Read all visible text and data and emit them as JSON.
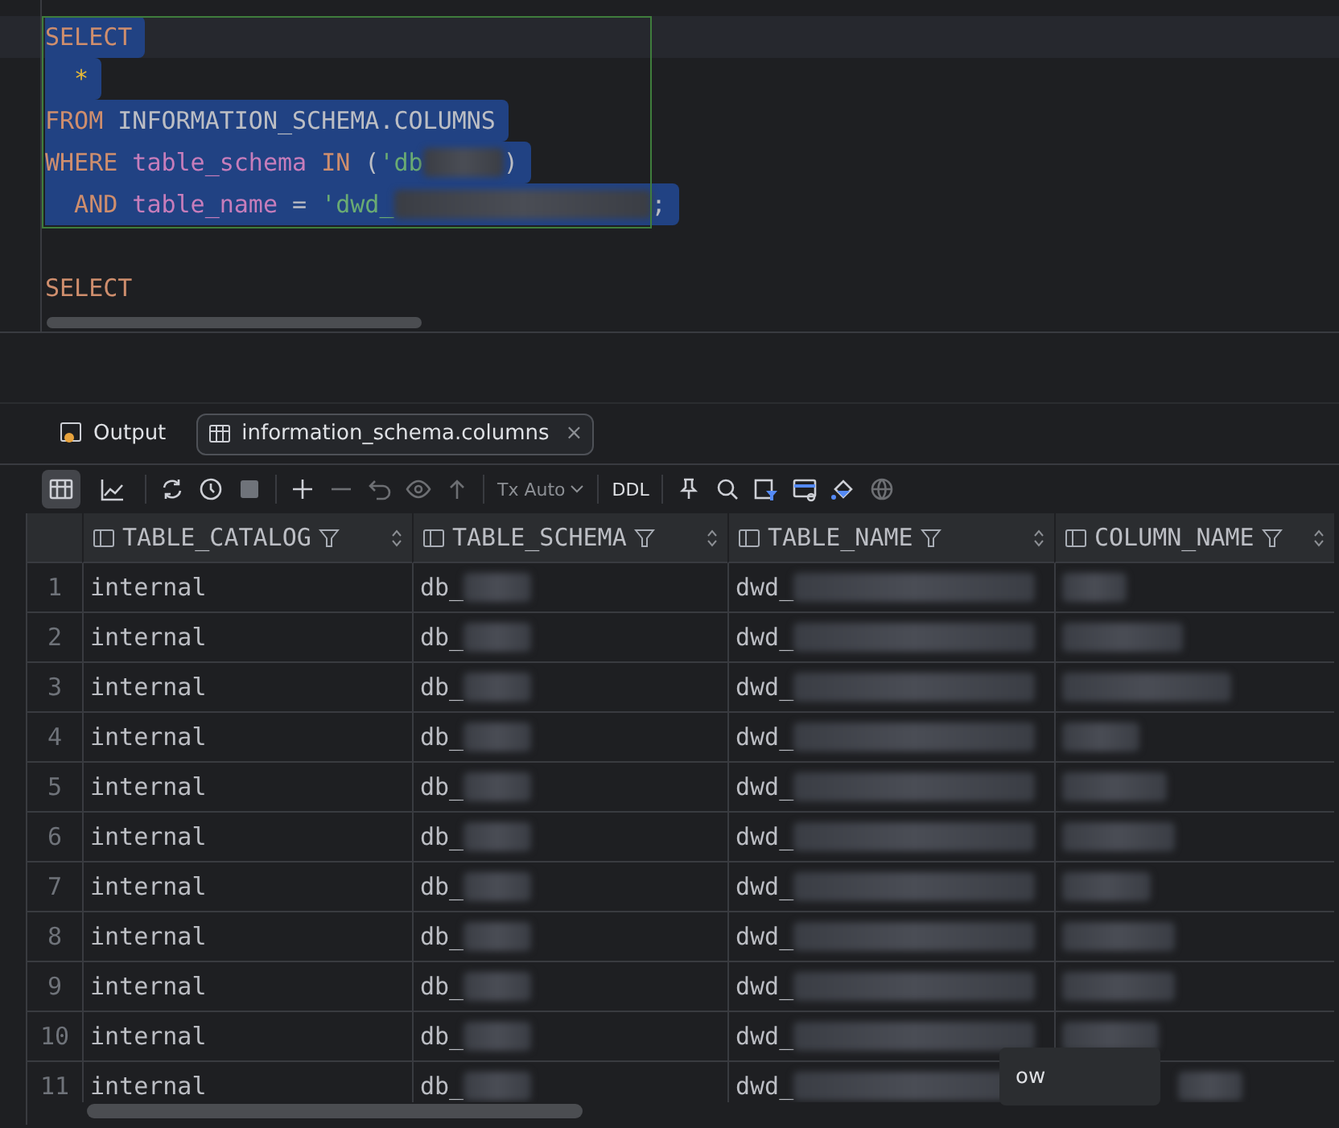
{
  "editor": {
    "lines": [
      {
        "selected": true,
        "current": true,
        "tokens": [
          {
            "text": "SELECT",
            "kind": "keyword"
          }
        ]
      },
      {
        "selected": true,
        "current": false,
        "tokens": [
          {
            "text": "  *",
            "kind": "star"
          }
        ]
      },
      {
        "selected": true,
        "current": false,
        "tokens": [
          {
            "text": "FROM",
            "kind": "keyword"
          },
          {
            "text": " INFORMATION_SCHEMA.COLUMNS",
            "kind": "plain"
          }
        ]
      },
      {
        "selected": true,
        "current": false,
        "tokens": [
          {
            "text": "WHERE",
            "kind": "keyword"
          },
          {
            "text": " table_schema",
            "kind": "column"
          },
          {
            "text": " IN",
            "kind": "keyword"
          },
          {
            "text": " (",
            "kind": "plain"
          },
          {
            "text": "'db",
            "kind": "string"
          },
          {
            "kind": "blur"
          },
          {
            "text": ")",
            "kind": "plain"
          }
        ]
      },
      {
        "selected": true,
        "current": false,
        "tokens": [
          {
            "text": "  AND",
            "kind": "keyword"
          },
          {
            "text": " table_name",
            "kind": "column"
          },
          {
            "text": " = ",
            "kind": "plain"
          },
          {
            "text": "'dwd_",
            "kind": "string"
          },
          {
            "kind": "blur"
          },
          {
            "text": ";",
            "kind": "plain"
          }
        ]
      },
      {
        "selected": false,
        "current": false
      },
      {
        "selected": false,
        "current": false,
        "tokens": [
          {
            "text": "SELECT",
            "kind": "keyword"
          }
        ]
      }
    ]
  },
  "result_tabs": [
    {
      "kind": "output",
      "label": "Output",
      "selected": false
    },
    {
      "kind": "table",
      "label": "information_schema.columns",
      "selected": true,
      "close": "×"
    }
  ],
  "toolbar": {
    "views": [
      {
        "kind": "table",
        "selected": true
      },
      {
        "kind": "chart",
        "selected": false
      }
    ],
    "transaction_mode": "Tx Auto",
    "ddl": "DDL"
  },
  "grid": {
    "columns": [
      "TABLE_CATALOG",
      "TABLE_SCHEMA",
      "TABLE_NAME",
      "COLUMN_NAME"
    ],
    "rows": [
      {
        "number": "1",
        "table_catalog": "internal",
        "table_schema": "db_",
        "table_name": "dwd_"
      },
      {
        "number": "2",
        "table_catalog": "internal",
        "table_schema": "db_",
        "table_name": "dwd_"
      },
      {
        "number": "3",
        "table_catalog": "internal",
        "table_schema": "db_",
        "table_name": "dwd_"
      },
      {
        "number": "4",
        "table_catalog": "internal",
        "table_schema": "db_",
        "table_name": "dwd_"
      },
      {
        "number": "5",
        "table_catalog": "internal",
        "table_schema": "db_",
        "table_name": "dwd_"
      },
      {
        "number": "6",
        "table_catalog": "internal",
        "table_schema": "db_",
        "table_name": "dwd_"
      },
      {
        "number": "7",
        "table_catalog": "internal",
        "table_schema": "db_",
        "table_name": "dwd_"
      },
      {
        "number": "8",
        "table_catalog": "internal",
        "table_schema": "db_",
        "table_name": "dwd_"
      },
      {
        "number": "9",
        "table_catalog": "internal",
        "table_schema": "db_",
        "table_name": "dwd_"
      },
      {
        "number": "10",
        "table_catalog": "internal",
        "table_schema": "db_",
        "table_name": "dwd_"
      },
      {
        "number": "11",
        "table_catalog": "internal",
        "table_schema": "db_",
        "table_name": "dwd_"
      }
    ],
    "popup_text": "ow"
  }
}
